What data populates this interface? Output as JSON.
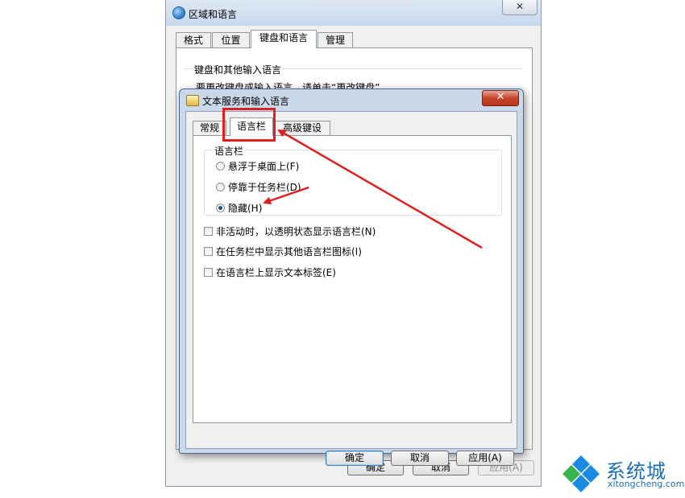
{
  "back_window": {
    "title": "区域和语言",
    "close_label": "✕",
    "tabs": [
      "格式",
      "位置",
      "键盘和语言",
      "管理"
    ],
    "active_tab": "键盘和语言",
    "group_label": "键盘和其他输入语言",
    "hint_text": "要更改键盘或输入语言，请单击“更改键盘”。",
    "buttons": {
      "ok": "确定",
      "cancel": "取消",
      "apply": "应用(A)"
    }
  },
  "dialog": {
    "title": "文本服务和输入语言",
    "close_label": "✕",
    "tabs": [
      "常规",
      "语言栏",
      "高级键设置"
    ],
    "active_tab": "语言栏",
    "group_label": "语言栏",
    "radios": [
      {
        "label": "悬浮于桌面上(F)",
        "checked": false
      },
      {
        "label": "停靠于任务栏(D)",
        "checked": false
      },
      {
        "label": "隐藏(H)",
        "checked": true
      }
    ],
    "checkboxes": [
      {
        "label": "非活动时，以透明状态显示语言栏(N)",
        "checked": false
      },
      {
        "label": "在任务栏中显示其他语言栏图标(I)",
        "checked": false
      },
      {
        "label": "在语言栏上显示文本标签(E)",
        "checked": false
      }
    ],
    "buttons": {
      "ok": "确定",
      "cancel": "取消",
      "apply": "应用(A)"
    }
  },
  "annotation_color": "#e02020",
  "watermark": {
    "name": "系统城",
    "url": "xitongcheng.com"
  }
}
